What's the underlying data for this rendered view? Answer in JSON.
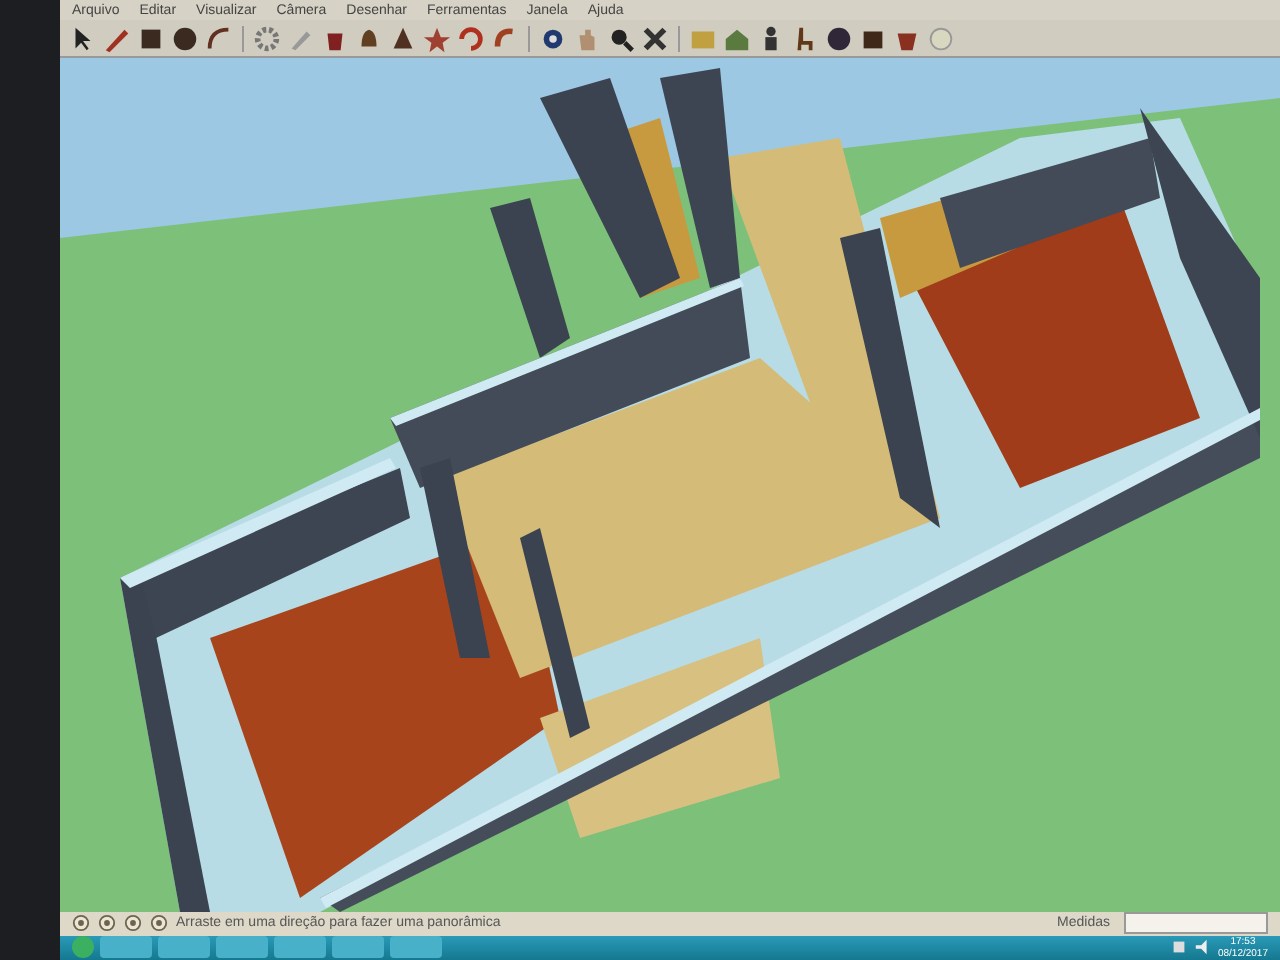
{
  "window": {
    "menu": [
      "Arquivo",
      "Editar",
      "Visualizar",
      "Câmera",
      "Desenhar",
      "Ferramentas",
      "Janela",
      "Ajuda"
    ]
  },
  "status_bar": {
    "hint": "Arraste em uma direção para fazer uma panorâmica",
    "measure_label": "Medidas"
  },
  "taskbar": {
    "time": "17:53",
    "date": "08/12/2017"
  }
}
